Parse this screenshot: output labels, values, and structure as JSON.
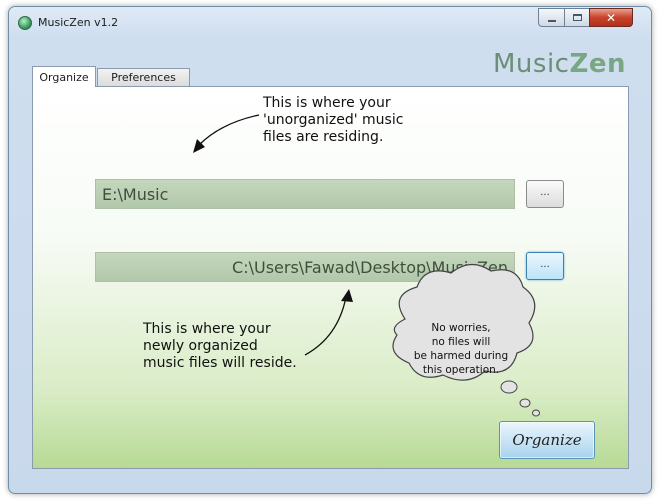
{
  "window": {
    "title": "MusicZen v1.2"
  },
  "brand": {
    "part1": "Music",
    "part2": "Zen"
  },
  "tabs": [
    {
      "label": "Organize",
      "active": true
    },
    {
      "label": "Preferences",
      "active": false
    }
  ],
  "notes": {
    "source": [
      "This is where your",
      "'unorganized' music",
      "files are residing."
    ],
    "destination": [
      "This is where your",
      "newly organized",
      "music files will reside."
    ],
    "reassurance": [
      "No worries,",
      "no files will",
      "be harmed during",
      "this operation."
    ]
  },
  "source_path": {
    "value": "E:\\Music",
    "browse_label": "..."
  },
  "destination_path": {
    "value": "C:\\Users\\Fawad\\Desktop\\MusicZen",
    "browse_label": "..."
  },
  "organize_button": {
    "label": "Organize"
  },
  "icons": {
    "app": "music-note-app-icon",
    "minimize": "minimize-icon",
    "maximize": "maximize-icon",
    "close": "close-icon",
    "cursor": "mouse-pointer-icon"
  },
  "colors": {
    "field_bg": "#b9cdb2",
    "brand": "#6d8e76",
    "panel_gradient_bottom": "#b7da95",
    "close_button": "#c8432b",
    "accent_blue": "#5c93b8"
  }
}
